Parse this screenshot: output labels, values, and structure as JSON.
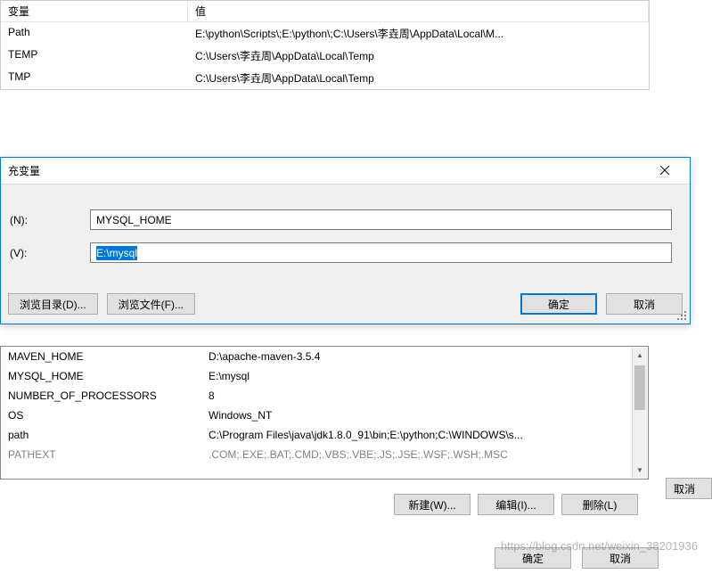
{
  "user_vars": {
    "header": {
      "variable": "变量",
      "value": "值"
    },
    "rows": [
      {
        "variable": "Path",
        "value": "E:\\python\\Scripts\\;E:\\python\\;C:\\Users\\李垚周\\AppData\\Local\\M..."
      },
      {
        "variable": "TEMP",
        "value": "C:\\Users\\李垚周\\AppData\\Local\\Temp"
      },
      {
        "variable": "TMP",
        "value": "C:\\Users\\李垚周\\AppData\\Local\\Temp"
      }
    ]
  },
  "dialog": {
    "title": "充变量",
    "name_label": "(N):",
    "value_label": "(V):",
    "name_input": "MYSQL_HOME",
    "value_input": "E:\\mysql",
    "browse_dir": "浏览目录(D)...",
    "browse_file": "浏览文件(F)...",
    "ok": "确定",
    "cancel": "取消"
  },
  "sys_vars": {
    "rows": [
      {
        "variable": "MAVEN_HOME",
        "value": "D:\\apache-maven-3.5.4"
      },
      {
        "variable": "MYSQL_HOME",
        "value": "E:\\mysql"
      },
      {
        "variable": "NUMBER_OF_PROCESSORS",
        "value": "8"
      },
      {
        "variable": "OS",
        "value": "Windows_NT"
      },
      {
        "variable": "path",
        "value": "C:\\Program Files\\java\\jdk1.8.0_91\\bin;E:\\python;C:\\WINDOWS\\s..."
      },
      {
        "variable": "PATHEXT",
        "value": ".COM;.EXE;.BAT;.CMD;.VBS;.VBE;.JS;.JSE;.WSF;.WSH;.MSC"
      }
    ]
  },
  "sys_buttons": {
    "new": "新建(W)...",
    "edit": "编辑(I)...",
    "delete": "删除(L)"
  },
  "parent_buttons": {
    "ok": "确定",
    "cancel": "取消"
  },
  "right_cancel": "取消",
  "watermark": "https://blog.csdn.net/weixin_38201936"
}
